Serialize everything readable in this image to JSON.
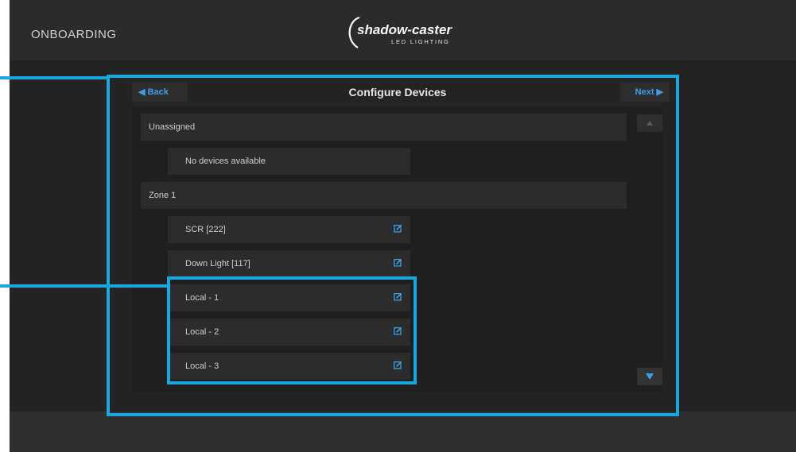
{
  "app": {
    "title": "ONBOARDING",
    "logo": {
      "main": "shadow-caster",
      "sub": "LED LIGHTING"
    }
  },
  "header": {
    "back_label": "◀ Back",
    "title": "Configure Devices",
    "next_label": "Next ▶"
  },
  "groups": [
    {
      "label": "Unassigned",
      "devices": [
        {
          "label": "No devices available",
          "editable": false
        }
      ]
    },
    {
      "label": "Zone 1",
      "devices": [
        {
          "label": "SCR [222]",
          "editable": true
        },
        {
          "label": "Down Light [117]",
          "editable": true
        },
        {
          "label": "Local - 1",
          "editable": true
        },
        {
          "label": "Local - 2",
          "editable": true
        },
        {
          "label": "Local - 3",
          "editable": true
        }
      ]
    }
  ],
  "icons": {
    "edit": "edit-icon",
    "scroll_up": "triangle-up-icon",
    "scroll_down": "triangle-down-icon"
  },
  "colors": {
    "accent": "#3aa0e6",
    "highlight": "#19a7e0",
    "background": "#232323"
  }
}
